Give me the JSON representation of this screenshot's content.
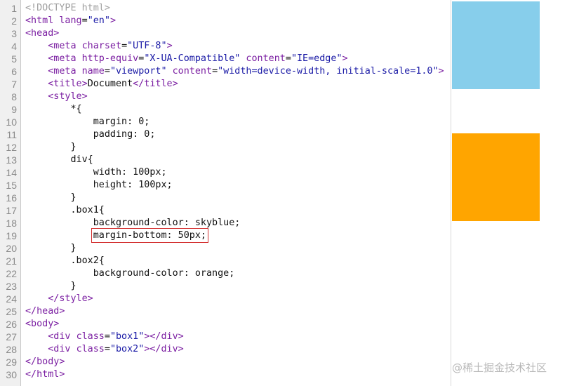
{
  "editor": {
    "lines": [
      {
        "n": "1",
        "segs": [
          {
            "t": "<!DOCTYPE html>",
            "c": "doctype"
          }
        ]
      },
      {
        "n": "2",
        "segs": [
          {
            "t": "<html ",
            "c": "tag"
          },
          {
            "t": "lang",
            "c": "attr"
          },
          {
            "t": "=",
            "c": "txt"
          },
          {
            "t": "\"en\"",
            "c": "val"
          },
          {
            "t": ">",
            "c": "tag"
          }
        ]
      },
      {
        "n": "3",
        "segs": [
          {
            "t": "<head>",
            "c": "tag"
          }
        ]
      },
      {
        "n": "4",
        "segs": [
          {
            "t": "    ",
            "c": "txt"
          },
          {
            "t": "<meta ",
            "c": "tag"
          },
          {
            "t": "charset",
            "c": "attr"
          },
          {
            "t": "=",
            "c": "txt"
          },
          {
            "t": "\"UTF-8\"",
            "c": "val"
          },
          {
            "t": ">",
            "c": "tag"
          }
        ]
      },
      {
        "n": "5",
        "segs": [
          {
            "t": "    ",
            "c": "txt"
          },
          {
            "t": "<meta ",
            "c": "tag"
          },
          {
            "t": "http-equiv",
            "c": "attr"
          },
          {
            "t": "=",
            "c": "txt"
          },
          {
            "t": "\"X-UA-Compatible\"",
            "c": "val"
          },
          {
            "t": " content",
            "c": "attr"
          },
          {
            "t": "=",
            "c": "txt"
          },
          {
            "t": "\"IE=edge\"",
            "c": "val"
          },
          {
            "t": ">",
            "c": "tag"
          }
        ]
      },
      {
        "n": "6",
        "segs": [
          {
            "t": "    ",
            "c": "txt"
          },
          {
            "t": "<meta ",
            "c": "tag"
          },
          {
            "t": "name",
            "c": "attr"
          },
          {
            "t": "=",
            "c": "txt"
          },
          {
            "t": "\"viewport\"",
            "c": "val"
          },
          {
            "t": " content",
            "c": "attr"
          },
          {
            "t": "=",
            "c": "txt"
          },
          {
            "t": "\"width=device-width, initial-scale=1.0\"",
            "c": "val"
          },
          {
            "t": ">",
            "c": "tag"
          }
        ]
      },
      {
        "n": "7",
        "segs": [
          {
            "t": "    ",
            "c": "txt"
          },
          {
            "t": "<title>",
            "c": "tag"
          },
          {
            "t": "Document",
            "c": "txt"
          },
          {
            "t": "</title>",
            "c": "tag"
          }
        ]
      },
      {
        "n": "8",
        "segs": [
          {
            "t": "    ",
            "c": "txt"
          },
          {
            "t": "<style>",
            "c": "tag"
          }
        ]
      },
      {
        "n": "9",
        "segs": [
          {
            "t": "        *{",
            "c": "txt"
          }
        ]
      },
      {
        "n": "10",
        "segs": [
          {
            "t": "            margin: 0;",
            "c": "txt"
          }
        ]
      },
      {
        "n": "11",
        "segs": [
          {
            "t": "            padding: 0;",
            "c": "txt"
          }
        ]
      },
      {
        "n": "12",
        "segs": [
          {
            "t": "        }",
            "c": "txt"
          }
        ]
      },
      {
        "n": "13",
        "segs": [
          {
            "t": "        div{",
            "c": "txt"
          }
        ]
      },
      {
        "n": "14",
        "segs": [
          {
            "t": "            width: 100px;",
            "c": "txt"
          }
        ]
      },
      {
        "n": "15",
        "segs": [
          {
            "t": "            height: 100px;",
            "c": "txt"
          }
        ]
      },
      {
        "n": "16",
        "segs": [
          {
            "t": "        }",
            "c": "txt"
          }
        ]
      },
      {
        "n": "17",
        "segs": [
          {
            "t": "        .box1{",
            "c": "txt"
          }
        ]
      },
      {
        "n": "18",
        "segs": [
          {
            "t": "            background-color: skyblue;",
            "c": "txt"
          }
        ]
      },
      {
        "n": "19",
        "segs": [
          {
            "t": "            ",
            "c": "txt"
          },
          {
            "t": "margin-bottom: 50px;",
            "c": "txt",
            "hl": true
          }
        ]
      },
      {
        "n": "20",
        "segs": [
          {
            "t": "        }",
            "c": "txt"
          }
        ]
      },
      {
        "n": "21",
        "segs": [
          {
            "t": "        .box2{",
            "c": "txt"
          }
        ]
      },
      {
        "n": "22",
        "segs": [
          {
            "t": "            background-color: orange;",
            "c": "txt"
          }
        ]
      },
      {
        "n": "23",
        "segs": [
          {
            "t": "        }",
            "c": "txt"
          }
        ]
      },
      {
        "n": "24",
        "segs": [
          {
            "t": "    ",
            "c": "txt"
          },
          {
            "t": "</style>",
            "c": "tag"
          }
        ]
      },
      {
        "n": "25",
        "segs": [
          {
            "t": "</head>",
            "c": "tag"
          }
        ]
      },
      {
        "n": "26",
        "segs": [
          {
            "t": "<body>",
            "c": "tag"
          }
        ]
      },
      {
        "n": "27",
        "segs": [
          {
            "t": "    ",
            "c": "txt"
          },
          {
            "t": "<div ",
            "c": "tag"
          },
          {
            "t": "class",
            "c": "attr"
          },
          {
            "t": "=",
            "c": "txt"
          },
          {
            "t": "\"box1\"",
            "c": "val"
          },
          {
            "t": "></div>",
            "c": "tag"
          }
        ]
      },
      {
        "n": "28",
        "segs": [
          {
            "t": "    ",
            "c": "txt"
          },
          {
            "t": "<div ",
            "c": "tag"
          },
          {
            "t": "class",
            "c": "attr"
          },
          {
            "t": "=",
            "c": "txt"
          },
          {
            "t": "\"box2\"",
            "c": "val"
          },
          {
            "t": "></div>",
            "c": "tag"
          }
        ]
      },
      {
        "n": "29",
        "segs": [
          {
            "t": "</body>",
            "c": "tag"
          }
        ]
      },
      {
        "n": "30",
        "segs": [
          {
            "t": "</html>",
            "c": "tag"
          }
        ]
      }
    ]
  },
  "preview": {
    "box1_color": "#87ceeb",
    "box2_color": "#ffa500"
  },
  "watermark": {
    "text": "@稀土掘金技术社区"
  },
  "colors": {
    "tag": "#7b1fa2",
    "value": "#1a1aa6",
    "text": "#111111",
    "doctype": "#a0a0a0",
    "highlight_border": "#d32f2f"
  }
}
